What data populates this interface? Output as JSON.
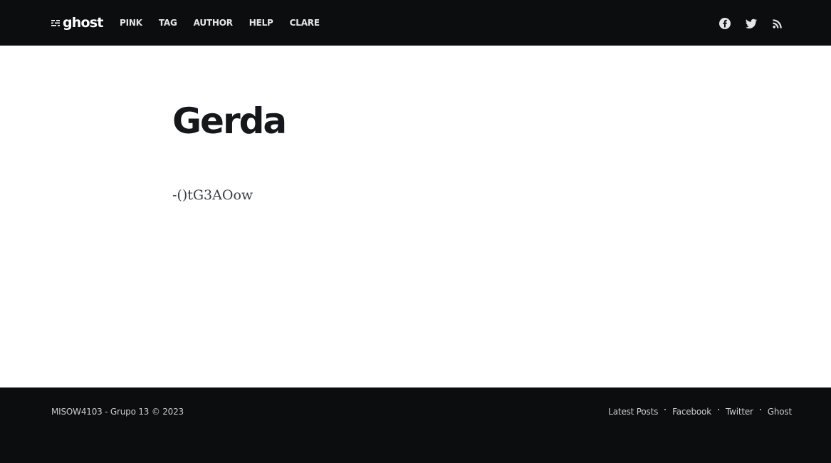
{
  "header": {
    "logo_text": "ghost",
    "nav": [
      {
        "label": "PINK"
      },
      {
        "label": "TAG"
      },
      {
        "label": "AUTHOR"
      },
      {
        "label": "HELP"
      },
      {
        "label": "CLARE"
      }
    ],
    "social_icons": [
      "facebook-icon",
      "twitter-icon",
      "rss-icon"
    ]
  },
  "post": {
    "title": "Gerda",
    "body": "-()tG3AOow"
  },
  "footer": {
    "copyright": "MISOW4103 - Grupo 13 © 2023",
    "links": [
      {
        "label": "Latest Posts"
      },
      {
        "label": "Facebook"
      },
      {
        "label": "Twitter"
      },
      {
        "label": "Ghost"
      }
    ]
  },
  "colors": {
    "header_bg": "#0c0d0f",
    "footer_bg": "#0c0d0f",
    "title_text": "#15171a",
    "nav_text": "#e6e6e6"
  }
}
